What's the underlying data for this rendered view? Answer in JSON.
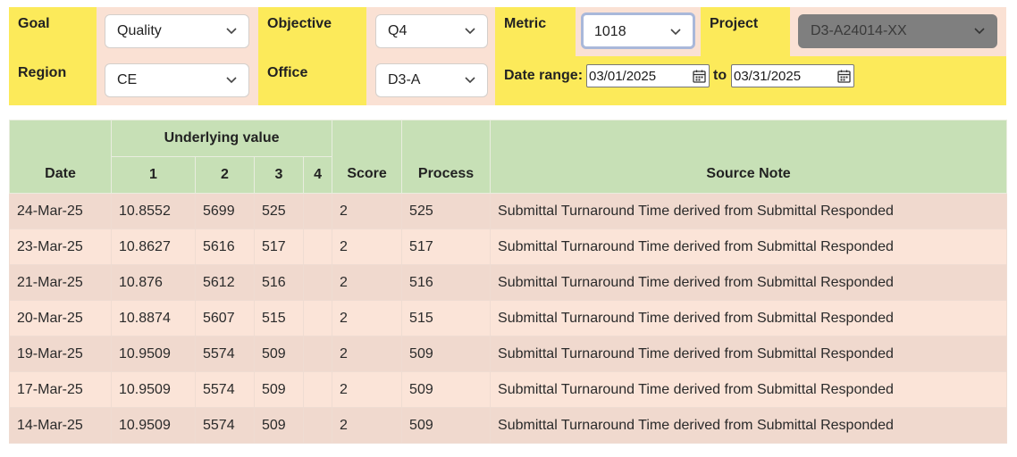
{
  "filters": {
    "goal": {
      "label": "Goal",
      "value": "Quality"
    },
    "objective": {
      "label": "Objective",
      "value": "Q4"
    },
    "metric": {
      "label": "Metric",
      "value": "1018"
    },
    "project": {
      "label": "Project",
      "value": "D3-A24014-XX"
    },
    "region": {
      "label": "Region",
      "value": "CE"
    },
    "office": {
      "label": "Office",
      "value": "D3-A"
    },
    "date_range": {
      "label": "Date range:",
      "from": "03/01/2025",
      "to_label": "to",
      "to": "03/31/2025"
    }
  },
  "table": {
    "headers": {
      "date": "Date",
      "underlying": "Underlying value",
      "sub": [
        "1",
        "2",
        "3",
        "4"
      ],
      "score": "Score",
      "process": "Process",
      "source_note": "Source Note"
    },
    "rows": [
      {
        "date": "24-Mar-25",
        "v1": "10.8552",
        "v2": "5699",
        "v3": "525",
        "v4": "",
        "score": "2",
        "process": "525",
        "note": "Submittal Turnaround Time derived from Submittal Responded"
      },
      {
        "date": "23-Mar-25",
        "v1": "10.8627",
        "v2": "5616",
        "v3": "517",
        "v4": "",
        "score": "2",
        "process": "517",
        "note": "Submittal Turnaround Time derived from Submittal Responded"
      },
      {
        "date": "21-Mar-25",
        "v1": "10.876",
        "v2": "5612",
        "v3": "516",
        "v4": "",
        "score": "2",
        "process": "516",
        "note": "Submittal Turnaround Time derived from Submittal Responded"
      },
      {
        "date": "20-Mar-25",
        "v1": "10.8874",
        "v2": "5607",
        "v3": "515",
        "v4": "",
        "score": "2",
        "process": "515",
        "note": "Submittal Turnaround Time derived from Submittal Responded"
      },
      {
        "date": "19-Mar-25",
        "v1": "10.9509",
        "v2": "5574",
        "v3": "509",
        "v4": "",
        "score": "2",
        "process": "509",
        "note": "Submittal Turnaround Time derived from Submittal Responded"
      },
      {
        "date": "17-Mar-25",
        "v1": "10.9509",
        "v2": "5574",
        "v3": "509",
        "v4": "",
        "score": "2",
        "process": "509",
        "note": "Submittal Turnaround Time derived from Submittal Responded"
      },
      {
        "date": "14-Mar-25",
        "v1": "10.9509",
        "v2": "5574",
        "v3": "509",
        "v4": "",
        "score": "2",
        "process": "509",
        "note": "Submittal Turnaround Time derived from Submittal Responded"
      }
    ]
  },
  "colors": {
    "label_bg": "#fcea5a",
    "cell_bg": "#fae1d4",
    "header_bg": "#c7e0b6",
    "row_odd": "#f0d9ce",
    "row_even": "#fbe4d8"
  }
}
